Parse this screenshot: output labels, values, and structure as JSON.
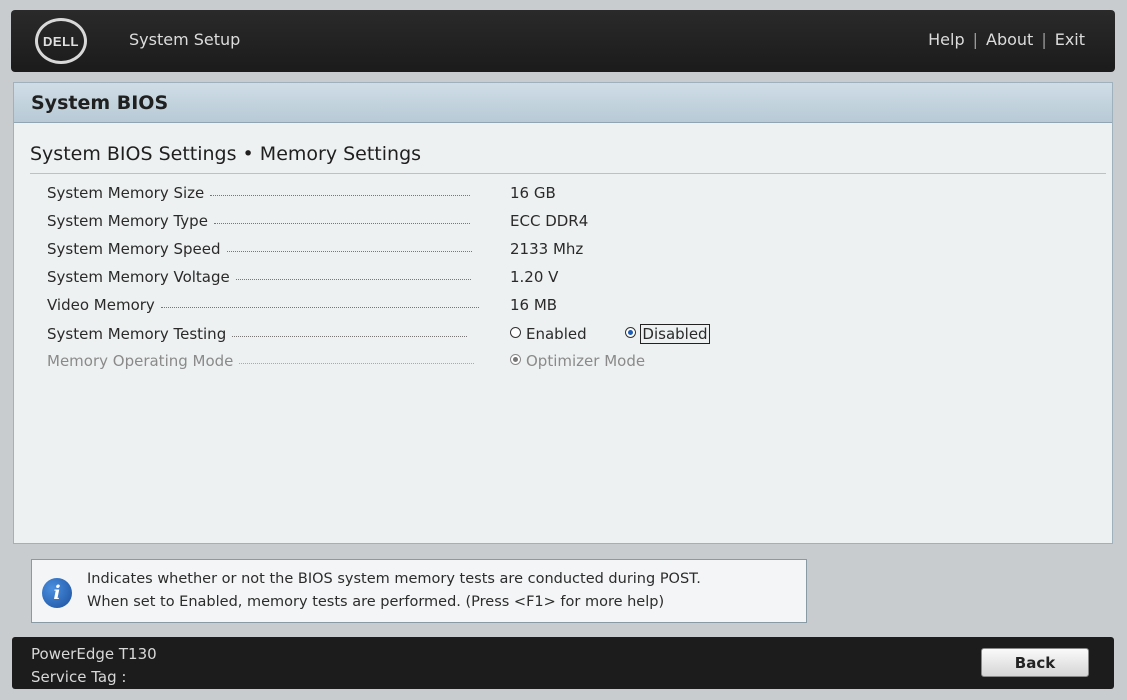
{
  "header": {
    "logo_text": "DELL",
    "app_title": "System Setup",
    "links": [
      "Help",
      "About",
      "Exit"
    ]
  },
  "panel": {
    "title": "System BIOS",
    "breadcrumb": "System BIOS Settings • Memory Settings"
  },
  "settings": [
    {
      "label": "System Memory Size",
      "value": "16 GB"
    },
    {
      "label": "System Memory Type",
      "value": "ECC DDR4"
    },
    {
      "label": "System Memory Speed",
      "value": "2133 Mhz"
    },
    {
      "label": "System Memory Voltage",
      "value": "1.20 V"
    },
    {
      "label": "Video Memory",
      "value": "16 MB"
    },
    {
      "label": "System Memory Testing",
      "options": [
        "Enabled",
        "Disabled"
      ],
      "selected": "Disabled"
    },
    {
      "label": "Memory Operating Mode",
      "options": [
        "Optimizer Mode"
      ],
      "selected": "Optimizer Mode",
      "disabled": true
    }
  ],
  "help": {
    "line1": "Indicates whether or not the BIOS system memory tests are conducted during POST.",
    "line2": "When set to Enabled, memory tests are performed. (Press <F1> for more help)"
  },
  "footer": {
    "model": "PowerEdge T130",
    "service_tag": "Service Tag :",
    "back_label": "Back"
  }
}
